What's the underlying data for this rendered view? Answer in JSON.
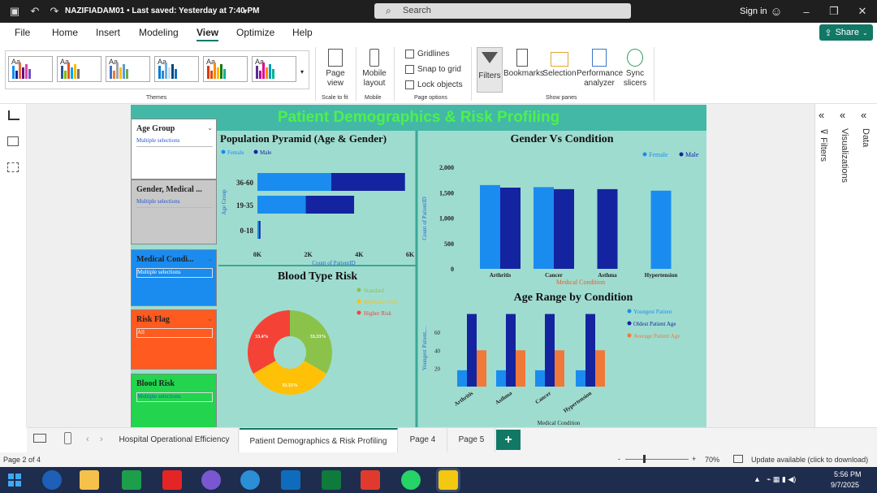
{
  "titlebar": {
    "title": "NAZIFIADAM01 • Last saved: Yesterday at 7:40 PM",
    "search_placeholder": "Search",
    "signin": "Sign in"
  },
  "menu": {
    "items": [
      "File",
      "Home",
      "Insert",
      "Modeling",
      "View",
      "Optimize",
      "Help"
    ],
    "active": "View",
    "share": "Share"
  },
  "ribbon": {
    "themes_label": "Themes",
    "page_view": "Page view",
    "mobile_layout": "Mobile layout",
    "scale_label": "Scale to fit",
    "mobile_label": "Mobile",
    "checks": [
      "Gridlines",
      "Snap to grid",
      "Lock objects"
    ],
    "page_options_label": "Page options",
    "panes": [
      "Filters",
      "Bookmarks",
      "Selection",
      "Performance analyzer",
      "Sync slicers"
    ],
    "show_panes_label": "Show panes"
  },
  "report": {
    "title": "Patient Demographics & Risk Profiling",
    "slicers": [
      {
        "header": "Age Group",
        "value": "Multiple selections",
        "bg": "#ffffff"
      },
      {
        "header": "Gender, Medical ...",
        "value": "Multiple selections",
        "bg": "#c8c8c8"
      },
      {
        "header": "Medical Condi...",
        "value": "Multiple selections",
        "bg": "#1a8cf0"
      },
      {
        "header": "Risk Flag",
        "value": "All",
        "bg": "#ff5a1f"
      },
      {
        "header": "Blood Risk",
        "value": "Multiple selections",
        "bg": "#22d44e"
      }
    ]
  },
  "chart_data": [
    {
      "type": "bar",
      "orientation": "horizontal",
      "stacked": true,
      "title": "Population Pyramid (Age & Gender)",
      "categories": [
        "36-60",
        "19-35",
        "0-18"
      ],
      "series": [
        {
          "name": "Female",
          "values": [
            2900,
            1900,
            60
          ],
          "color": "#1a8cf0"
        },
        {
          "name": "Male",
          "values": [
            2900,
            1900,
            60
          ],
          "color": "#1424a0"
        }
      ],
      "xlabel": "Count of PatientID",
      "ylabel": "Age Group",
      "xticks": [
        "0K",
        "2K",
        "4K",
        "6K"
      ],
      "xlim": [
        0,
        6000
      ],
      "legend": "top-left"
    },
    {
      "type": "bar",
      "title": "Gender Vs Condition",
      "categories": [
        "Arthritis",
        "Cancer",
        "Asthma",
        "Hypertension"
      ],
      "series": [
        {
          "name": "Female",
          "values": [
            1650,
            1610,
            null,
            1540
          ],
          "color": "#1a8cf0"
        },
        {
          "name": "Male",
          "values": [
            1600,
            1570,
            1570,
            null
          ],
          "color": "#1424a0"
        }
      ],
      "xlabel": "Medical Condition",
      "ylabel": "Count of PatientID",
      "yticks": [
        "0",
        "500",
        "1,000",
        "1,500",
        "2,000"
      ],
      "ylim": [
        0,
        2000
      ],
      "legend": "top-right"
    },
    {
      "type": "pie",
      "donut": true,
      "title": "Blood Type Risk",
      "labels": [
        "Standard",
        "Moderate Risk",
        "Higher Risk"
      ],
      "values": [
        33.33,
        33.33,
        33.33
      ],
      "value_labels": [
        "33.33%",
        "33.33%",
        "33.4%"
      ],
      "colors": [
        "#8bc34a",
        "#ffc107",
        "#f44336"
      ],
      "legend": "top-right"
    },
    {
      "type": "bar",
      "title": "Age Range by Condition",
      "categories": [
        "Arthritis",
        "Asthma",
        "Cancer",
        "Hypertension"
      ],
      "series": [
        {
          "name": "Youngest Patient",
          "values": [
            18,
            18,
            18,
            18
          ],
          "color": "#1a8cf0"
        },
        {
          "name": "Oldest Patient Age",
          "values": [
            80,
            80,
            80,
            80
          ],
          "color": "#1424a0"
        },
        {
          "name": "Average Patient Age",
          "values": [
            40,
            40,
            40,
            40
          ],
          "color": "#f07838"
        }
      ],
      "xlabel": "Medical Condition",
      "ylabel": "Youngest Patient,...",
      "yticks": [
        "20",
        "40",
        "60"
      ],
      "ylim": [
        0,
        85
      ],
      "legend": "top-right"
    }
  ],
  "right_panes": [
    "Filters",
    "Visualizations",
    "Data"
  ],
  "pages": {
    "tabs": [
      "Hospital Operational Efficiency",
      "Patient Demographics & Risk Profiling",
      "Page 4",
      "Page 5"
    ],
    "active": 1,
    "add": "+"
  },
  "status": {
    "page": "Page 2 of 4",
    "zoom": "70%",
    "update": "Update available (click to download)"
  },
  "clock": {
    "time": "5:56 PM",
    "date": "9/7/2025"
  }
}
